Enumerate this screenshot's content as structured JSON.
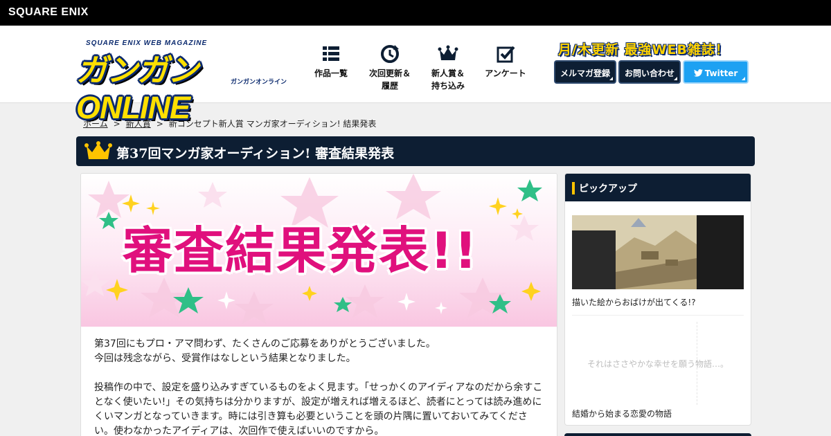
{
  "topbar": {
    "logo": "SQUARE ENIX"
  },
  "brand": {
    "sub": "SQUARE ENIX WEB MAGAZINE",
    "main": "ガンガンONLINE",
    "kana": "ガンガンオンライン"
  },
  "nav": [
    {
      "label": "作品一覧",
      "icon": "grid-list-icon"
    },
    {
      "label": "次回更新＆\n履歴",
      "icon": "clock-update-icon"
    },
    {
      "label": "新人賞＆\n持ち込み",
      "icon": "crown-icon"
    },
    {
      "label": "アンケート",
      "icon": "checkbox-icon"
    }
  ],
  "slogan": "月/木更新 最強WEB雑誌！",
  "header_buttons": {
    "mailmag": "メルマガ登録",
    "contact": "お問い合わせ",
    "twitter": "Twitter"
  },
  "breadcrumb": {
    "home": "ホーム",
    "prize": "新人賞",
    "current": "新コンセプト新人賞 マンガ家オーディション! 結果発表"
  },
  "page_title": "第37回マンガ家オーディション! 審査結果発表",
  "banner_text": "審査結果発表!!",
  "body": {
    "p1_line1": "第37回にもプロ・アマ問わず、たくさんのご応募をありがとうございました。",
    "p1_line2": "今回は残念ながら、受賞作はなしという結果となりました。",
    "p2": "投稿作の中で、設定を盛り込みすぎているものをよく見ます。「せっかくのアイディアなのだから余すことなく使いたい!」その気持ちは分かりますが、設定が増えれば増えるほど、読者にとっては読み進めにくいマンガとなっていきます。時には引き算も必要ということを頭の片隅に置いておいてみてください。使わなかったアイディアは、次回作で使えばいいのですから。"
  },
  "sidebar": {
    "title": "ピックアップ",
    "items": [
      {
        "caption": "描いた絵からおばけが出てくる!?"
      },
      {
        "overlay": "それはささやかな幸せを願う物語…。",
        "caption": "結婚から始まる恋愛の物語"
      }
    ]
  },
  "colors": {
    "navy": "#0d1e33",
    "gold": "#ffc400",
    "pink": "#e0107d",
    "twitter": "#1da1f2"
  }
}
